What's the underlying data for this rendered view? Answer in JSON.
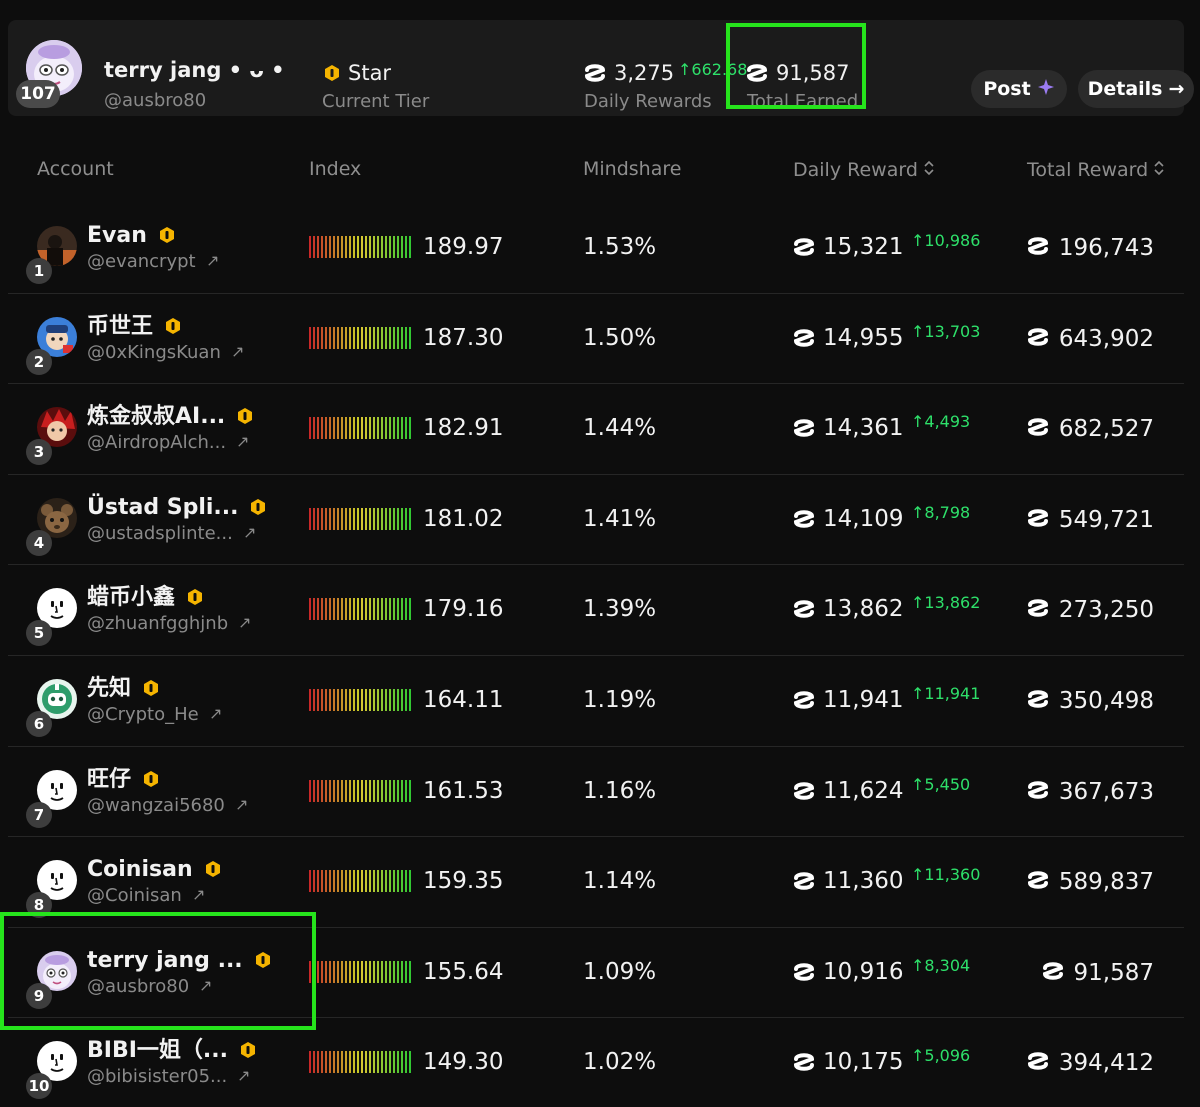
{
  "summary": {
    "name": "terry jang • ᴗ •",
    "handle": "@ausbro80",
    "rank": "107",
    "tier": "Star",
    "tier_label": "Current Tier",
    "daily_value": "3,275",
    "daily_delta": "↑662.68",
    "daily_label": "Daily Rewards",
    "total_value": "91,587",
    "total_label": "Total Earned",
    "post_label": "Post",
    "details_label": "Details",
    "details_arrow": "→"
  },
  "table": {
    "headers": {
      "account": "Account",
      "index": "Index",
      "mindshare": "Mindshare",
      "daily_reward": "Daily Reward",
      "total_reward": "Total Reward",
      "sort_glyph": "⌃⌄"
    },
    "ext_glyph": "↗",
    "rows": [
      {
        "rank": "1",
        "name": "Evan",
        "handle": "@evancrypt",
        "index": "189.97",
        "mindshare": "1.53%",
        "daily": "15,321",
        "delta": "↑10,986",
        "total": "196,743",
        "avatar": "photo-dark"
      },
      {
        "rank": "2",
        "name": "币世王",
        "handle": "@0xKingsKuan",
        "index": "187.30",
        "mindshare": "1.50%",
        "daily": "14,955",
        "delta": "↑13,703",
        "total": "643,902",
        "avatar": "cartoon-blue"
      },
      {
        "rank": "3",
        "name": "炼金叔叔AI...",
        "handle": "@AirdropAlch...",
        "index": "182.91",
        "mindshare": "1.44%",
        "daily": "14,361",
        "delta": "↑4,493",
        "total": "682,527",
        "avatar": "anime-red"
      },
      {
        "rank": "4",
        "name": "Üstad Spli...",
        "handle": "@ustadsplinte...",
        "index": "181.02",
        "mindshare": "1.41%",
        "daily": "14,109",
        "delta": "↑8,798",
        "total": "549,721",
        "avatar": "rat-brown"
      },
      {
        "rank": "5",
        "name": "蜡币小鑫",
        "handle": "@zhuanfgghjnb",
        "index": "179.16",
        "mindshare": "1.39%",
        "daily": "13,862",
        "delta": "↑13,862",
        "total": "273,250",
        "avatar": "default-face"
      },
      {
        "rank": "6",
        "name": "先知",
        "handle": "@Crypto_He",
        "index": "164.11",
        "mindshare": "1.19%",
        "daily": "11,941",
        "delta": "↑11,941",
        "total": "350,498",
        "avatar": "robot-green"
      },
      {
        "rank": "7",
        "name": "旺仔",
        "handle": "@wangzai5680",
        "index": "161.53",
        "mindshare": "1.16%",
        "daily": "11,624",
        "delta": "↑5,450",
        "total": "367,673",
        "avatar": "default-face"
      },
      {
        "rank": "8",
        "name": "Coinisan",
        "handle": "@Coinisan",
        "index": "159.35",
        "mindshare": "1.14%",
        "daily": "11,360",
        "delta": "↑11,360",
        "total": "589,837",
        "avatar": "default-face"
      },
      {
        "rank": "9",
        "name": "terry jang ...",
        "handle": "@ausbro80",
        "index": "155.64",
        "mindshare": "1.09%",
        "daily": "10,916",
        "delta": "↑8,304",
        "total": "91,587",
        "avatar": "cartoon-lilac"
      },
      {
        "rank": "10",
        "name": "BIBI一姐（...",
        "handle": "@bibisister05...",
        "index": "149.30",
        "mindshare": "1.02%",
        "daily": "10,175",
        "delta": "↑5,096",
        "total": "394,412",
        "avatar": "default-face"
      }
    ]
  },
  "colors": {
    "background": "#0d0d0d",
    "card": "#1b1b1b",
    "positive": "#2ee06a",
    "highlight": "#26e41c",
    "tier_badge": "#f5b400"
  }
}
